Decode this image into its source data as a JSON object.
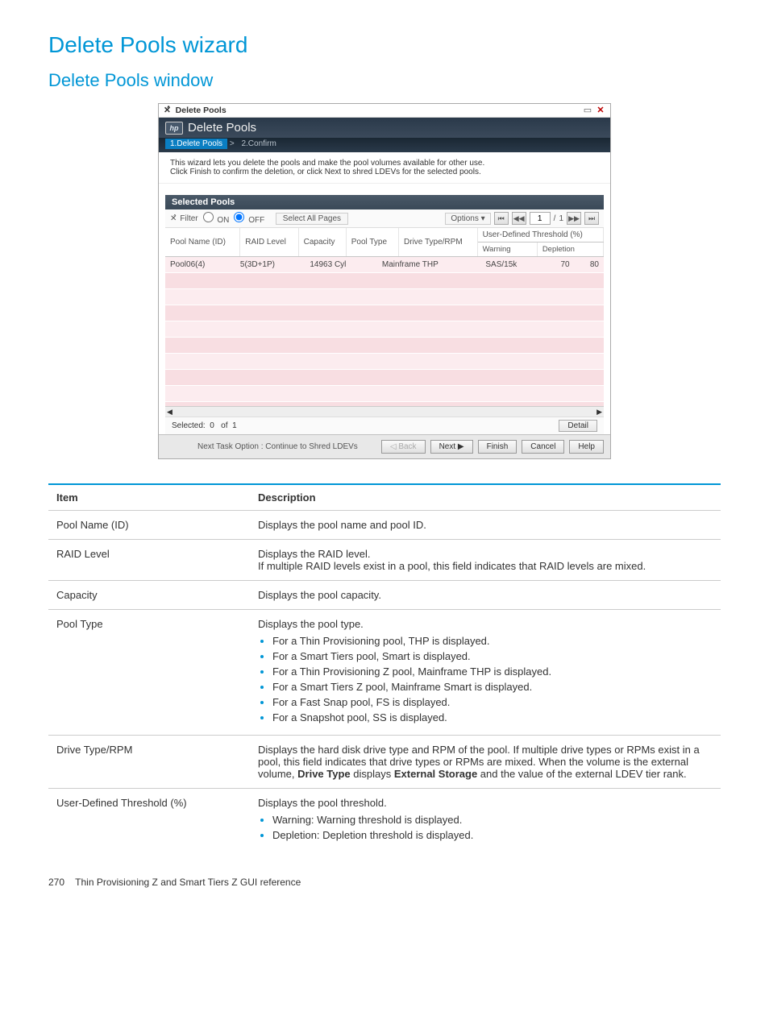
{
  "heading1": "Delete Pools wizard",
  "heading2": "Delete Pools window",
  "window": {
    "titlebar": "Delete Pools",
    "header_title": "Delete Pools",
    "breadcrumb_step1": "1.Delete Pools",
    "breadcrumb_sep": ">",
    "breadcrumb_step2": "2.Confirm",
    "instruction1": "This wizard lets you delete the pools and make the pool volumes available for other use.",
    "instruction2": "Click Finish to confirm the deletion, or click Next to shred LDEVs for the selected pools.",
    "section_title": "Selected Pools",
    "filter_label": "Filter",
    "filter_on": "ON",
    "filter_off": "OFF",
    "select_all_pages": "Select All Pages",
    "options_label": "Options",
    "page_current": "1",
    "page_sep": "/",
    "page_total": "1",
    "columns": {
      "pool_name": "Pool Name (ID)",
      "raid": "RAID Level",
      "capacity": "Capacity",
      "pool_type": "Pool Type",
      "drive": "Drive Type/RPM",
      "threshold": "User-Defined Threshold (%)",
      "warning": "Warning",
      "depletion": "Depletion"
    },
    "row": {
      "pool_name": "Pool06(4)",
      "raid": "5(3D+1P)",
      "capacity": "14963 Cyl",
      "pool_type": "Mainframe THP",
      "drive": "SAS/15k",
      "warning": "70",
      "depletion": "80"
    },
    "selected_label": "Selected:",
    "selected_count": "0",
    "selected_of": "of",
    "selected_total": "1",
    "detail_btn": "Detail",
    "footer_note": "Next Task Option : Continue to Shred LDEVs",
    "back": "Back",
    "next": "Next",
    "finish": "Finish",
    "cancel": "Cancel",
    "help": "Help"
  },
  "desc_table": {
    "th_item": "Item",
    "th_desc": "Description",
    "r1_item": "Pool Name (ID)",
    "r1_desc": "Displays the pool name and pool ID.",
    "r2_item": "RAID Level",
    "r2_desc1": "Displays the RAID level.",
    "r2_desc2": "If multiple RAID levels exist in a pool, this field indicates that RAID levels are mixed.",
    "r3_item": "Capacity",
    "r3_desc": "Displays the pool capacity.",
    "r4_item": "Pool Type",
    "r4_desc_intro": "Displays the pool type.",
    "r4_b1": "For a Thin Provisioning pool, THP is displayed.",
    "r4_b2": "For a Smart Tiers pool, Smart is displayed.",
    "r4_b3": "For a Thin Provisioning Z pool, Mainframe THP is displayed.",
    "r4_b4": "For a Smart Tiers Z pool, Mainframe Smart is displayed.",
    "r4_b5": "For a Fast Snap pool, FS is displayed.",
    "r4_b6": "For a Snapshot pool, SS is displayed.",
    "r5_item": "Drive Type/RPM",
    "r5_desc_a": "Displays the hard disk drive type and RPM of the pool. If multiple drive types or RPMs exist in a pool, this field indicates that drive types or RPMs are mixed. When the volume is the external volume, ",
    "r5_bold1": "Drive Type",
    "r5_desc_b": " displays ",
    "r5_bold2": "External Storage",
    "r5_desc_c": " and the value of the external LDEV tier rank.",
    "r6_item": "User-Defined Threshold (%)",
    "r6_desc_intro": "Displays the pool threshold.",
    "r6_b1": "Warning: Warning threshold is displayed.",
    "r6_b2": "Depletion: Depletion threshold is displayed."
  },
  "footer": {
    "page_num": "270",
    "chapter": "Thin Provisioning Z and Smart Tiers Z GUI reference"
  }
}
